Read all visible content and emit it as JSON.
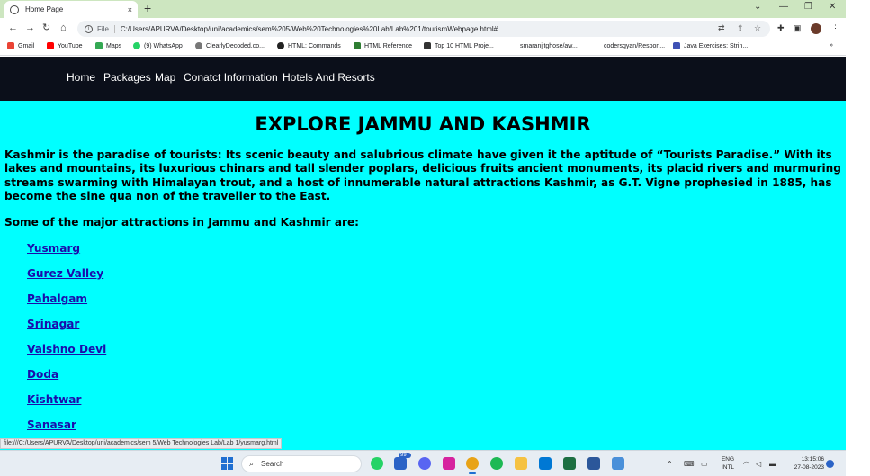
{
  "browser": {
    "tab_title": "Home Page",
    "tab_close": "×",
    "new_tab": "+",
    "url_scheme_label": "File",
    "url": "C:/Users/APURVA/Desktop/uni/academics/sem%205/Web%20Technologies%20Lab/Lab%201/tourismWebpage.html#",
    "bookmarks": [
      {
        "label": "Gmail",
        "color": "#ea4335"
      },
      {
        "label": "YouTube",
        "color": "#ff0000"
      },
      {
        "label": "Maps",
        "color": "#34a853"
      },
      {
        "label": "(9) WhatsApp",
        "color": "#25d366"
      },
      {
        "label": "ClearlyDecoded.co...",
        "color": "#777777"
      },
      {
        "label": "HTML: Commands",
        "color": "#222222"
      },
      {
        "label": "HTML Reference",
        "color": "#2e7d32"
      },
      {
        "label": "Top 10 HTML Proje...",
        "color": "#333333"
      },
      {
        "label": "smaranjitghose/aw...",
        "color": "#ffffff"
      },
      {
        "label": "codersgyan/Respon...",
        "color": "#ffffff"
      },
      {
        "label": "Java Exercises: Strin...",
        "color": "#3f51b5"
      }
    ],
    "bookmarks_more": "»",
    "status_url": "file:///C:/Users/APURVA/Desktop/uni/academics/sem 5/Web Technologies Lab/Lab 1/yusmarg.html"
  },
  "nav": {
    "items": [
      "Home",
      "Packages",
      "Map",
      "Conatct Information",
      "Hotels And Resorts"
    ]
  },
  "main": {
    "heading": "EXPLORE JAMMU AND KASHMIR",
    "paragraph": "Kashmir is the paradise of tourists: Its scenic beauty and salubrious climate have given it the aptitude of “Tourists Paradise.” With its lakes and mountains, its luxurious chinars and tall slender poplars, delicious fruits ancient monuments, its placid rivers and murmuring streams swarming with Himalayan trout, and a host of innumerable natural attractions Kashmir, as G.T. Vigne prophesied in 1885, has become the sine qua non of the traveller to the East.",
    "subheading": "Some of the major attractions in Jammu and Kashmir are:",
    "attractions": [
      "Yusmarg",
      "Gurez Valley",
      "Pahalgam",
      "Srinagar",
      "Vaishno Devi",
      "Doda",
      "Kishtwar",
      "Sanasar"
    ]
  },
  "taskbar": {
    "search_placeholder": "Search",
    "mail_badge": "99+",
    "language": "ENG",
    "layout": "INTL",
    "time": "13:15:06",
    "date": "27-08-2023"
  },
  "colors": {
    "page_background": "#00ffff",
    "nav_background": "#0b0f1a",
    "link": "#1a0dab"
  }
}
